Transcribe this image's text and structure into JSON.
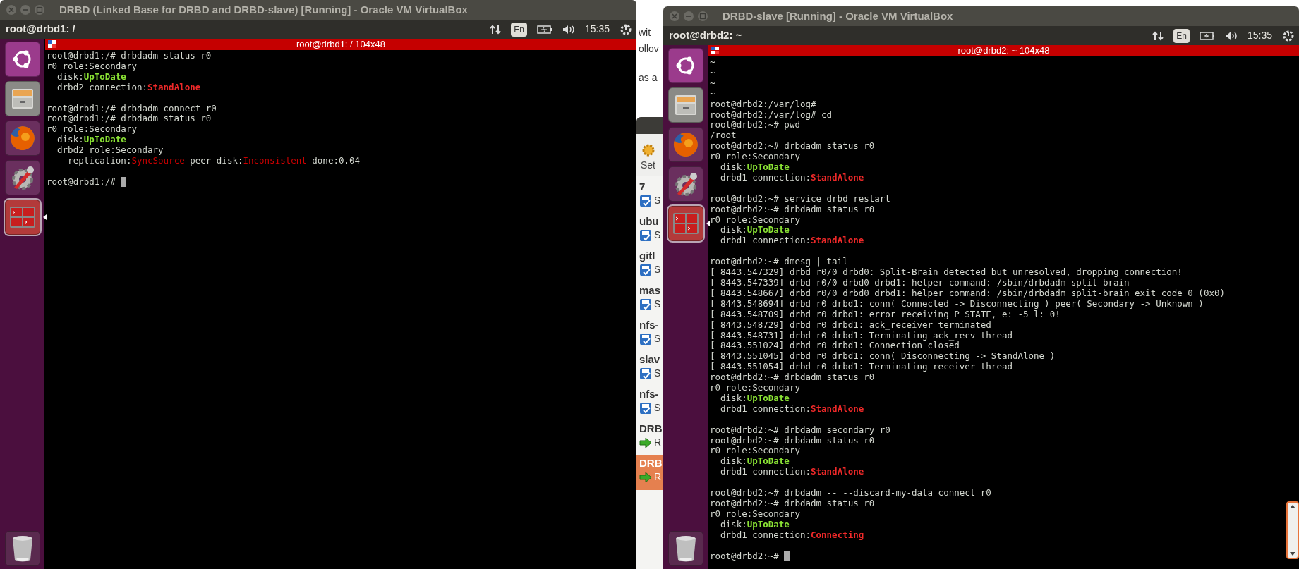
{
  "background_page": {
    "fragments": [
      "wit",
      "ollov",
      "as a"
    ]
  },
  "manager": {
    "toolbar": {
      "label": "Set"
    },
    "vms": [
      {
        "name": "7",
        "status": "S",
        "kind": "saved",
        "selected": false
      },
      {
        "name": "ubu",
        "status": "S",
        "kind": "saved",
        "selected": false
      },
      {
        "name": "gitl",
        "status": "S",
        "kind": "saved",
        "selected": false
      },
      {
        "name": "mas",
        "status": "S",
        "kind": "saved",
        "selected": false
      },
      {
        "name": "nfs-",
        "status": "S",
        "kind": "saved",
        "selected": false
      },
      {
        "name": "slav",
        "status": "S",
        "kind": "saved",
        "selected": false
      },
      {
        "name": "nfs-",
        "status": "S",
        "kind": "saved",
        "selected": false
      },
      {
        "name": "DRB",
        "status": "R",
        "kind": "running",
        "selected": false
      },
      {
        "name": "DRB",
        "status": "R",
        "kind": "running",
        "selected": true
      }
    ]
  },
  "windows": [
    {
      "title": "DRBD (Linked Base for DRBD and DRBD-slave) [Running] - Oracle VM VirtualBox",
      "panel": {
        "app_title": "root@drbd1: /",
        "keyboard": "En",
        "clock": "15:35"
      },
      "launcher": [
        {
          "kind": "ubuntu",
          "selected": false
        },
        {
          "kind": "files",
          "selected": false
        },
        {
          "kind": "firefox",
          "selected": false
        },
        {
          "kind": "settings",
          "selected": false
        },
        {
          "kind": "terminal",
          "selected": true
        },
        {
          "kind": "trash",
          "selected": false
        }
      ],
      "terminal": {
        "title": "root@drbd1: / 104x48",
        "lines": [
          {
            "kind": "text",
            "segments": [
              {
                "text": "root@drbd1:/# drbdadm status r0",
                "kind": "plain"
              }
            ]
          },
          {
            "kind": "text",
            "segments": [
              {
                "text": "r0 role:Secondary",
                "kind": "plain"
              }
            ]
          },
          {
            "kind": "text",
            "segments": [
              {
                "text": "  disk:",
                "kind": "plain"
              },
              {
                "text": "UpToDate",
                "kind": "ok"
              }
            ]
          },
          {
            "kind": "text",
            "segments": [
              {
                "text": "  drbd2 connection:",
                "kind": "plain"
              },
              {
                "text": "StandAlone",
                "kind": "error"
              }
            ]
          },
          {
            "kind": "blank"
          },
          {
            "kind": "text",
            "segments": [
              {
                "text": "root@drbd1:/# drbdadm connect r0",
                "kind": "plain"
              }
            ]
          },
          {
            "kind": "text",
            "segments": [
              {
                "text": "root@drbd1:/# drbdadm status r0",
                "kind": "plain"
              }
            ]
          },
          {
            "kind": "text",
            "segments": [
              {
                "text": "r0 role:Secondary",
                "kind": "plain"
              }
            ]
          },
          {
            "kind": "text",
            "segments": [
              {
                "text": "  disk:",
                "kind": "plain"
              },
              {
                "text": "UpToDate",
                "kind": "ok"
              }
            ]
          },
          {
            "kind": "text",
            "segments": [
              {
                "text": "  drbd2 role:Secondary",
                "kind": "plain"
              }
            ]
          },
          {
            "kind": "text",
            "segments": [
              {
                "text": "    replication:",
                "kind": "plain"
              },
              {
                "text": "SyncSource",
                "kind": "warn"
              },
              {
                "text": " peer-disk:",
                "kind": "plain"
              },
              {
                "text": "Inconsistent",
                "kind": "warn"
              },
              {
                "text": " done:0.04",
                "kind": "plain"
              }
            ]
          },
          {
            "kind": "blank"
          },
          {
            "kind": "cursor",
            "segments": [
              {
                "text": "root@drbd1:/# ",
                "kind": "plain"
              }
            ]
          }
        ]
      }
    },
    {
      "title": "DRBD-slave [Running] - Oracle VM VirtualBox",
      "panel": {
        "app_title": "root@drbd2: ~",
        "keyboard": "En",
        "clock": "15:35"
      },
      "launcher": [
        {
          "kind": "ubuntu",
          "selected": false
        },
        {
          "kind": "files",
          "selected": false
        },
        {
          "kind": "firefox",
          "selected": false
        },
        {
          "kind": "settings",
          "selected": false
        },
        {
          "kind": "terminal",
          "selected": true
        },
        {
          "kind": "trash",
          "selected": false
        }
      ],
      "terminal": {
        "title": "root@drbd2: ~ 104x48",
        "scrollbar": true,
        "lines": [
          {
            "kind": "text",
            "segments": [
              {
                "text": "~",
                "kind": "plain"
              }
            ]
          },
          {
            "kind": "text",
            "segments": [
              {
                "text": "~",
                "kind": "plain"
              }
            ]
          },
          {
            "kind": "text",
            "segments": [
              {
                "text": "~",
                "kind": "plain"
              }
            ]
          },
          {
            "kind": "text",
            "segments": [
              {
                "text": "~",
                "kind": "plain"
              }
            ]
          },
          {
            "kind": "text",
            "segments": [
              {
                "text": "root@drbd2:/var/log#",
                "kind": "plain"
              }
            ]
          },
          {
            "kind": "text",
            "segments": [
              {
                "text": "root@drbd2:/var/log# cd",
                "kind": "plain"
              }
            ]
          },
          {
            "kind": "text",
            "segments": [
              {
                "text": "root@drbd2:~# pwd",
                "kind": "plain"
              }
            ]
          },
          {
            "kind": "text",
            "segments": [
              {
                "text": "/root",
                "kind": "plain"
              }
            ]
          },
          {
            "kind": "text",
            "segments": [
              {
                "text": "root@drbd2:~# drbdadm status r0",
                "kind": "plain"
              }
            ]
          },
          {
            "kind": "text",
            "segments": [
              {
                "text": "r0 role:Secondary",
                "kind": "plain"
              }
            ]
          },
          {
            "kind": "text",
            "segments": [
              {
                "text": "  disk:",
                "kind": "plain"
              },
              {
                "text": "UpToDate",
                "kind": "ok"
              }
            ]
          },
          {
            "kind": "text",
            "segments": [
              {
                "text": "  drbd1 connection:",
                "kind": "plain"
              },
              {
                "text": "StandAlone",
                "kind": "error"
              }
            ]
          },
          {
            "kind": "blank"
          },
          {
            "kind": "text",
            "segments": [
              {
                "text": "root@drbd2:~# service drbd restart",
                "kind": "plain"
              }
            ]
          },
          {
            "kind": "text",
            "segments": [
              {
                "text": "root@drbd2:~# drbdadm status r0",
                "kind": "plain"
              }
            ]
          },
          {
            "kind": "text",
            "segments": [
              {
                "text": "r0 role:Secondary",
                "kind": "plain"
              }
            ]
          },
          {
            "kind": "text",
            "segments": [
              {
                "text": "  disk:",
                "kind": "plain"
              },
              {
                "text": "UpToDate",
                "kind": "ok"
              }
            ]
          },
          {
            "kind": "text",
            "segments": [
              {
                "text": "  drbd1 connection:",
                "kind": "plain"
              },
              {
                "text": "StandAlone",
                "kind": "error"
              }
            ]
          },
          {
            "kind": "blank"
          },
          {
            "kind": "text",
            "segments": [
              {
                "text": "root@drbd2:~# dmesg | tail",
                "kind": "plain"
              }
            ]
          },
          {
            "kind": "text",
            "segments": [
              {
                "text": "[ 8443.547329] drbd r0/0 drbd0: Split-Brain detected but unresolved, dropping connection!",
                "kind": "plain"
              }
            ]
          },
          {
            "kind": "text",
            "segments": [
              {
                "text": "[ 8443.547339] drbd r0/0 drbd0 drbd1: helper command: /sbin/drbdadm split-brain",
                "kind": "plain"
              }
            ]
          },
          {
            "kind": "text",
            "segments": [
              {
                "text": "[ 8443.548667] drbd r0/0 drbd0 drbd1: helper command: /sbin/drbdadm split-brain exit code 0 (0x0)",
                "kind": "plain"
              }
            ]
          },
          {
            "kind": "text",
            "segments": [
              {
                "text": "[ 8443.548694] drbd r0 drbd1: conn( Connected -> Disconnecting ) peer( Secondary -> Unknown )",
                "kind": "plain"
              }
            ]
          },
          {
            "kind": "text",
            "segments": [
              {
                "text": "[ 8443.548709] drbd r0 drbd1: error receiving P_STATE, e: -5 l: 0!",
                "kind": "plain"
              }
            ]
          },
          {
            "kind": "text",
            "segments": [
              {
                "text": "[ 8443.548729] drbd r0 drbd1: ack_receiver terminated",
                "kind": "plain"
              }
            ]
          },
          {
            "kind": "text",
            "segments": [
              {
                "text": "[ 8443.548731] drbd r0 drbd1: Terminating ack_recv thread",
                "kind": "plain"
              }
            ]
          },
          {
            "kind": "text",
            "segments": [
              {
                "text": "[ 8443.551024] drbd r0 drbd1: Connection closed",
                "kind": "plain"
              }
            ]
          },
          {
            "kind": "text",
            "segments": [
              {
                "text": "[ 8443.551045] drbd r0 drbd1: conn( Disconnecting -> StandAlone )",
                "kind": "plain"
              }
            ]
          },
          {
            "kind": "text",
            "segments": [
              {
                "text": "[ 8443.551054] drbd r0 drbd1: Terminating receiver thread",
                "kind": "plain"
              }
            ]
          },
          {
            "kind": "text",
            "segments": [
              {
                "text": "root@drbd2:~# drbdadm status r0",
                "kind": "plain"
              }
            ]
          },
          {
            "kind": "text",
            "segments": [
              {
                "text": "r0 role:Secondary",
                "kind": "plain"
              }
            ]
          },
          {
            "kind": "text",
            "segments": [
              {
                "text": "  disk:",
                "kind": "plain"
              },
              {
                "text": "UpToDate",
                "kind": "ok"
              }
            ]
          },
          {
            "kind": "text",
            "segments": [
              {
                "text": "  drbd1 connection:",
                "kind": "plain"
              },
              {
                "text": "StandAlone",
                "kind": "error"
              }
            ]
          },
          {
            "kind": "blank"
          },
          {
            "kind": "text",
            "segments": [
              {
                "text": "root@drbd2:~# drbdadm secondary r0",
                "kind": "plain"
              }
            ]
          },
          {
            "kind": "text",
            "segments": [
              {
                "text": "root@drbd2:~# drbdadm status r0",
                "kind": "plain"
              }
            ]
          },
          {
            "kind": "text",
            "segments": [
              {
                "text": "r0 role:Secondary",
                "kind": "plain"
              }
            ]
          },
          {
            "kind": "text",
            "segments": [
              {
                "text": "  disk:",
                "kind": "plain"
              },
              {
                "text": "UpToDate",
                "kind": "ok"
              }
            ]
          },
          {
            "kind": "text",
            "segments": [
              {
                "text": "  drbd1 connection:",
                "kind": "plain"
              },
              {
                "text": "StandAlone",
                "kind": "error"
              }
            ]
          },
          {
            "kind": "blank"
          },
          {
            "kind": "text",
            "segments": [
              {
                "text": "root@drbd2:~# drbdadm -- --discard-my-data connect r0",
                "kind": "plain"
              }
            ]
          },
          {
            "kind": "text",
            "segments": [
              {
                "text": "root@drbd2:~# drbdadm status r0",
                "kind": "plain"
              }
            ]
          },
          {
            "kind": "text",
            "segments": [
              {
                "text": "r0 role:Secondary",
                "kind": "plain"
              }
            ]
          },
          {
            "kind": "text",
            "segments": [
              {
                "text": "  disk:",
                "kind": "plain"
              },
              {
                "text": "UpToDate",
                "kind": "ok"
              }
            ]
          },
          {
            "kind": "text",
            "segments": [
              {
                "text": "  drbd1 connection:",
                "kind": "plain"
              },
              {
                "text": "Connecting",
                "kind": "error"
              }
            ]
          },
          {
            "kind": "blank"
          },
          {
            "kind": "cursor",
            "segments": [
              {
                "text": "root@drbd2:~# ",
                "kind": "plain"
              }
            ]
          }
        ]
      }
    }
  ]
}
